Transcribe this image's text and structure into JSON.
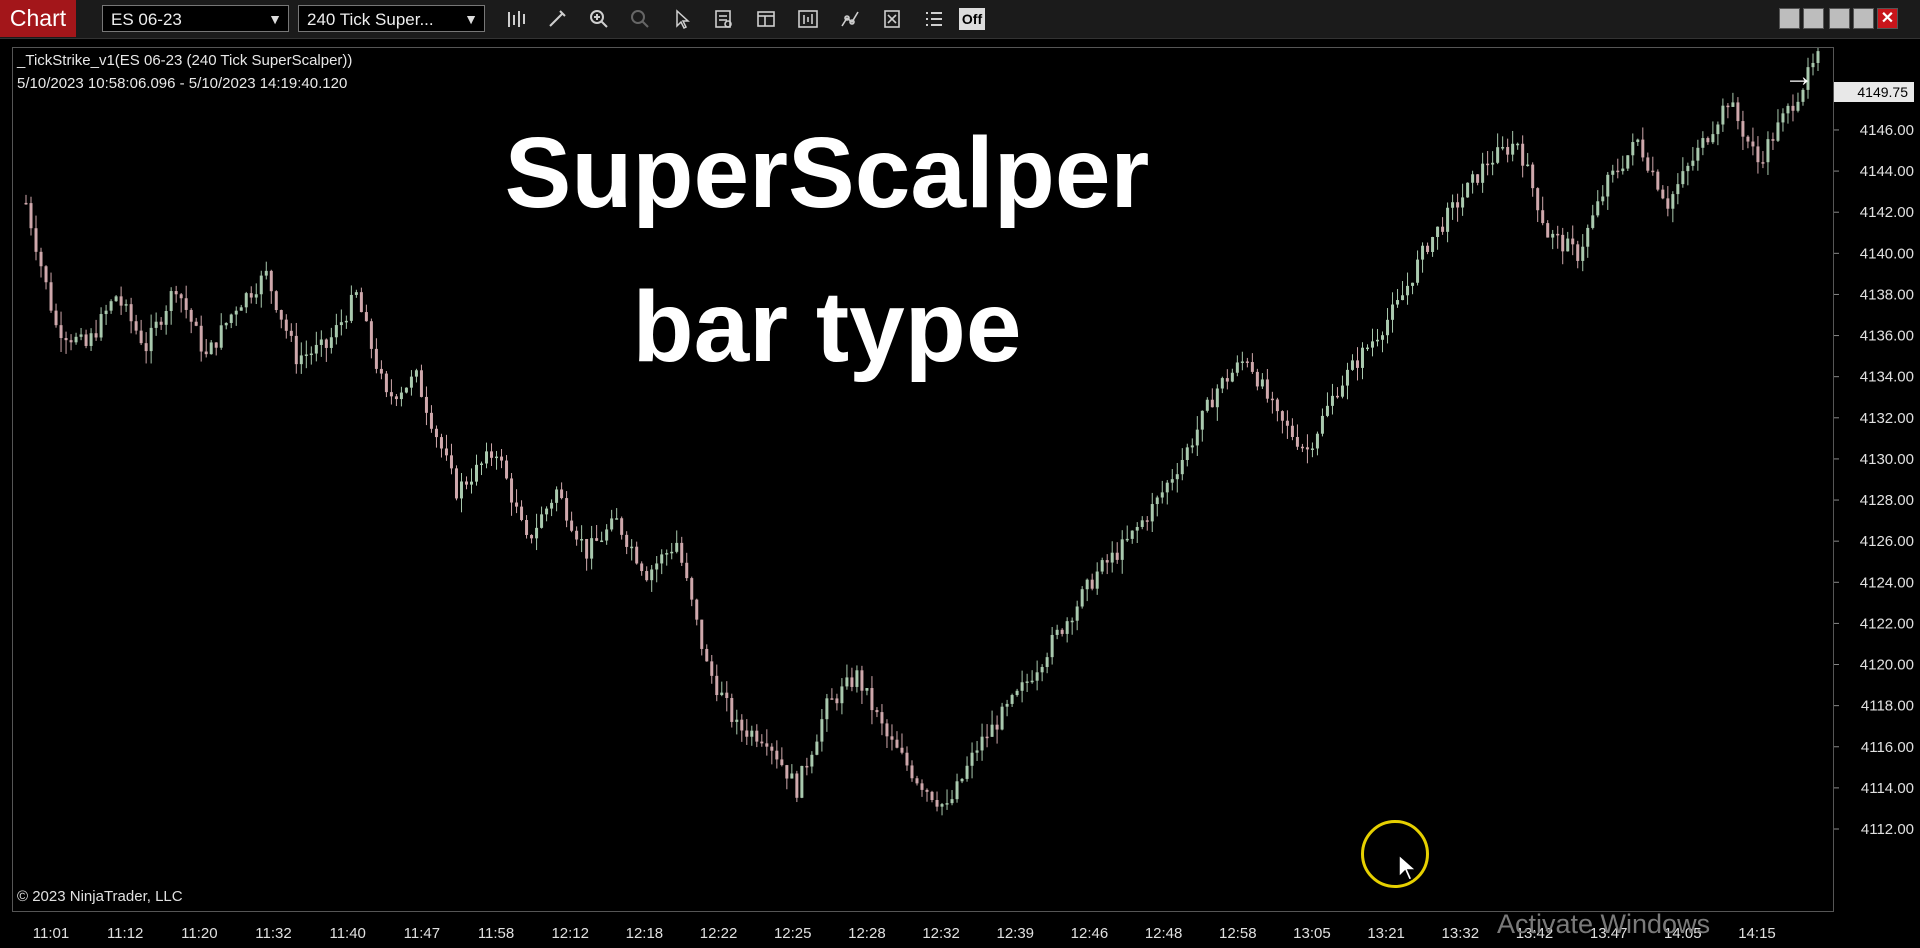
{
  "toolbar": {
    "app_label": "Chart",
    "instrument": "ES 06-23",
    "bar_type": "240 Tick Super...",
    "off_label": "Off"
  },
  "chart_info": {
    "title": "_TickStrike_v1(ES 06-23 (240 Tick SuperScalper))",
    "date_range": "5/10/2023 10:58:06.096 - 5/10/2023 14:19:40.120"
  },
  "overlay": {
    "line1": "SuperScalper",
    "line2": "bar type"
  },
  "copyright": "© 2023 NinjaTrader, LLC",
  "watermark": "Activate Windows",
  "current_price": "4149.75",
  "colors": {
    "up_bar": "#a9c9ae",
    "down_bar": "#cfa8ac",
    "background": "#000000",
    "brand_red": "#a3161a",
    "cursor_highlight": "#e6d000"
  },
  "chart_data": {
    "type": "candlestick",
    "ylim": [
      4111,
      4151
    ],
    "y_ticks": [
      4112,
      4114,
      4116,
      4118,
      4120,
      4122,
      4124,
      4126,
      4128,
      4130,
      4132,
      4134,
      4136,
      4138,
      4140,
      4142,
      4144,
      4146,
      4148
    ],
    "y_tick_labels": [
      "4112.00",
      "4114.00",
      "4116.00",
      "4118.00",
      "4120.00",
      "4122.00",
      "4124.00",
      "4126.00",
      "4128.00",
      "4130.00",
      "4132.00",
      "4134.00",
      "4136.00",
      "4138.00",
      "4140.00",
      "4142.00",
      "4144.00",
      "4146.00",
      "4148.00"
    ],
    "x_tick_labels": [
      "11:01",
      "11:12",
      "11:20",
      "11:32",
      "11:40",
      "11:47",
      "11:58",
      "12:12",
      "12:18",
      "12:22",
      "12:25",
      "12:28",
      "12:32",
      "12:39",
      "12:46",
      "12:48",
      "12:58",
      "13:05",
      "13:21",
      "13:32",
      "13:42",
      "13:47",
      "14:05",
      "14:15"
    ],
    "path": [
      [
        0,
        4142.5
      ],
      [
        6,
        4136.5
      ],
      [
        12,
        4135.5
      ],
      [
        18,
        4138.0
      ],
      [
        24,
        4135.5
      ],
      [
        30,
        4138.5
      ],
      [
        36,
        4135.0
      ],
      [
        42,
        4137.5
      ],
      [
        48,
        4139.0
      ],
      [
        54,
        4135.0
      ],
      [
        60,
        4135.5
      ],
      [
        66,
        4138.0
      ],
      [
        72,
        4133.0
      ],
      [
        78,
        4134.0
      ],
      [
        86,
        4128.5
      ],
      [
        94,
        4130.5
      ],
      [
        100,
        4126.0
      ],
      [
        106,
        4128.5
      ],
      [
        112,
        4125.5
      ],
      [
        118,
        4127.0
      ],
      [
        124,
        4124.5
      ],
      [
        130,
        4126.0
      ],
      [
        136,
        4120.0
      ],
      [
        142,
        4117.0
      ],
      [
        148,
        4116.5
      ],
      [
        154,
        4114.0
      ],
      [
        160,
        4118.0
      ],
      [
        166,
        4119.5
      ],
      [
        172,
        4116.5
      ],
      [
        178,
        4114.5
      ],
      [
        184,
        4113.0
      ],
      [
        190,
        4116.0
      ],
      [
        198,
        4118.5
      ],
      [
        206,
        4121.5
      ],
      [
        214,
        4124.5
      ],
      [
        220,
        4126.0
      ],
      [
        226,
        4128.0
      ],
      [
        232,
        4130.5
      ],
      [
        238,
        4133.5
      ],
      [
        244,
        4135.0
      ],
      [
        250,
        4132.0
      ],
      [
        256,
        4130.5
      ],
      [
        262,
        4133.5
      ],
      [
        268,
        4135.5
      ],
      [
        274,
        4137.5
      ],
      [
        280,
        4140.5
      ],
      [
        286,
        4142.5
      ],
      [
        292,
        4144.5
      ],
      [
        298,
        4145.5
      ],
      [
        304,
        4141.0
      ],
      [
        310,
        4140.0
      ],
      [
        316,
        4143.5
      ],
      [
        322,
        4145.5
      ],
      [
        328,
        4142.5
      ],
      [
        334,
        4145.0
      ],
      [
        340,
        4147.5
      ],
      [
        346,
        4144.5
      ],
      [
        352,
        4147.0
      ],
      [
        358,
        4149.5
      ]
    ]
  }
}
